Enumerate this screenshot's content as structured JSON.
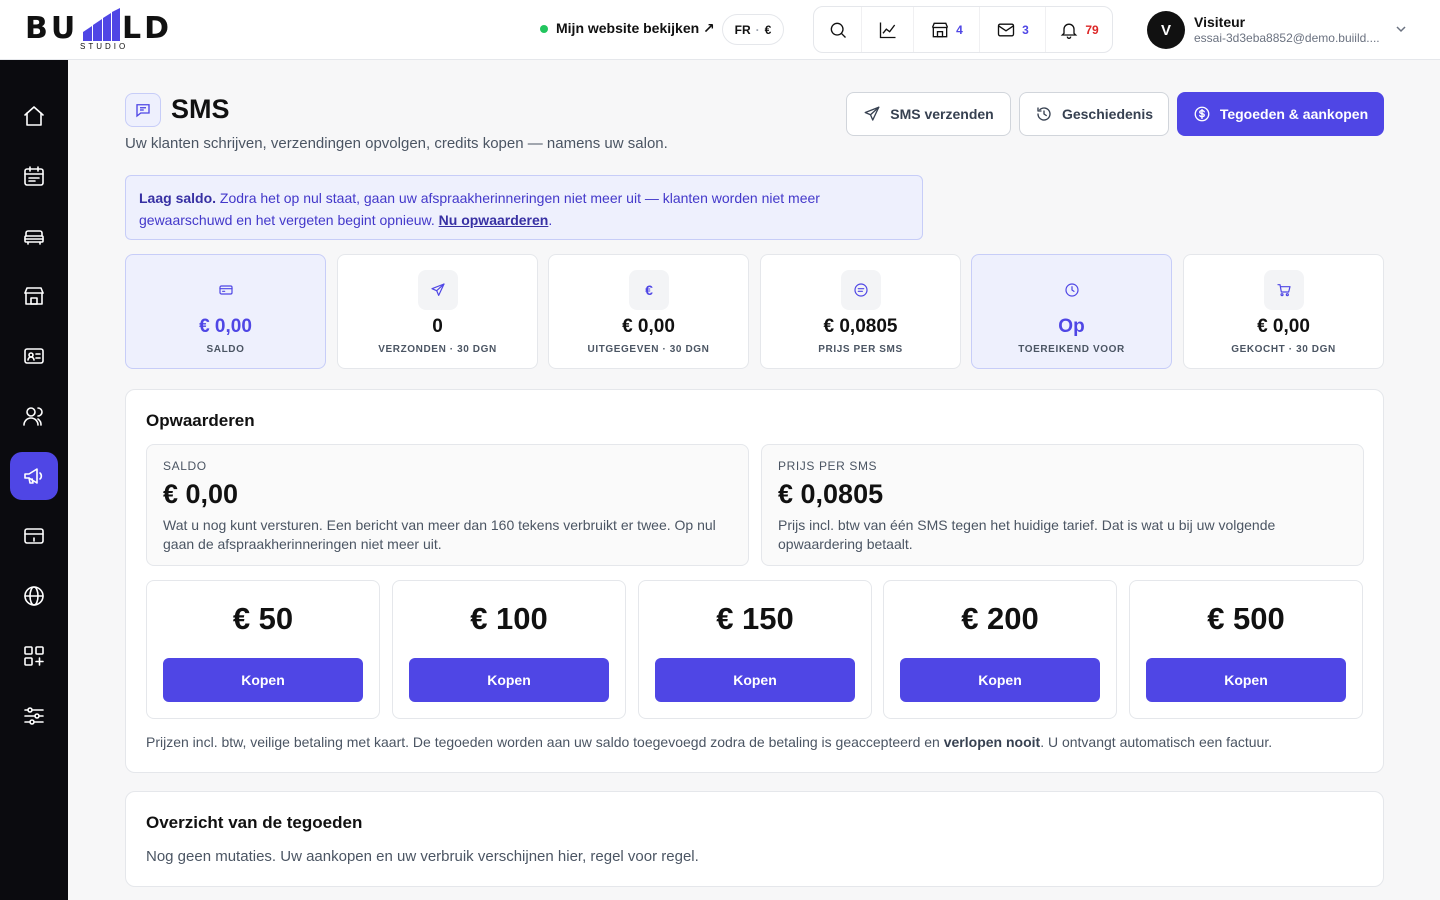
{
  "brand": {
    "word_left": "BU",
    "word_right": "LD",
    "sub": "STUDIO"
  },
  "topbar": {
    "site_link": "Mijn website bekijken ↗",
    "lang": "FR",
    "currency": "€",
    "counts": {
      "shop": "4",
      "mail": "3",
      "notifications": "79"
    },
    "user": {
      "initial": "V",
      "name": "Visiteur",
      "email": "essai-3d3eba8852@demo.buiild...."
    }
  },
  "page": {
    "title": "SMS",
    "subtitle": "Uw klanten schrijven, verzendingen opvolgen, credits kopen — namens uw salon.",
    "buttons": {
      "send": "SMS verzenden",
      "history": "Geschiedenis",
      "credits": "Tegoeden & aankopen"
    }
  },
  "alert": {
    "bold": "Laag saldo.",
    "text": " Zodra het op nul staat, gaan uw afspraakherinneringen niet meer uit — klanten worden niet meer gewaarschuwd en het vergeten begint opnieuw. ",
    "link": "Nu opwaarderen",
    "end": "."
  },
  "stats": [
    {
      "value": "€ 0,00",
      "label": "SALDO",
      "icon": "card-icon"
    },
    {
      "value": "0",
      "label": "VERZONDEN · 30 DGN",
      "icon": "send-icon"
    },
    {
      "value": "€ 0,00",
      "label": "UITGEGEVEN · 30 DGN",
      "icon": "euro-icon"
    },
    {
      "value": "€ 0,0805",
      "label": "PRIJS PER SMS",
      "icon": "message-icon"
    },
    {
      "value": "Op",
      "label": "TOEREIKEND VOOR",
      "icon": "clock-icon"
    },
    {
      "value": "€ 0,00",
      "label": "GEKOCHT · 30 DGN",
      "icon": "cart-icon"
    }
  ],
  "topup": {
    "title": "Opwaarderen",
    "balance": {
      "caption": "SALDO",
      "value": "€ 0,00",
      "desc": "Wat u nog kunt versturen. Een bericht van meer dan 160 tekens verbruikt er twee. Op nul gaan de afspraakherinneringen niet meer uit."
    },
    "price": {
      "caption": "PRIJS PER SMS",
      "value": "€ 0,0805",
      "desc": "Prijs incl. btw van één SMS tegen het huidige tarief. Dat is wat u bij uw volgende opwaardering betaalt."
    },
    "packs": [
      {
        "amount": "€ 50",
        "button": "Kopen"
      },
      {
        "amount": "€ 100",
        "button": "Kopen"
      },
      {
        "amount": "€ 150",
        "button": "Kopen"
      },
      {
        "amount": "€ 200",
        "button": "Kopen"
      },
      {
        "amount": "€ 500",
        "button": "Kopen"
      }
    ],
    "footer": {
      "text": "Prijzen incl. btw, veilige betaling met kaart. De tegoeden worden aan uw saldo toegevoegd zodra de betaling is geaccepteerd en ",
      "bold": "verlopen nooit",
      "end": ". U ontvangt automatisch een factuur."
    }
  },
  "overview": {
    "title": "Overzicht van de tegoeden",
    "empty": "Nog geen mutaties. Uw aankopen en uw verbruik verschijnen hier, regel voor regel."
  },
  "colors": {
    "accent": "#4f46e5",
    "sidebar": "#0b0b0f",
    "online": "#22c55e",
    "alert_count": "#dc2626"
  }
}
